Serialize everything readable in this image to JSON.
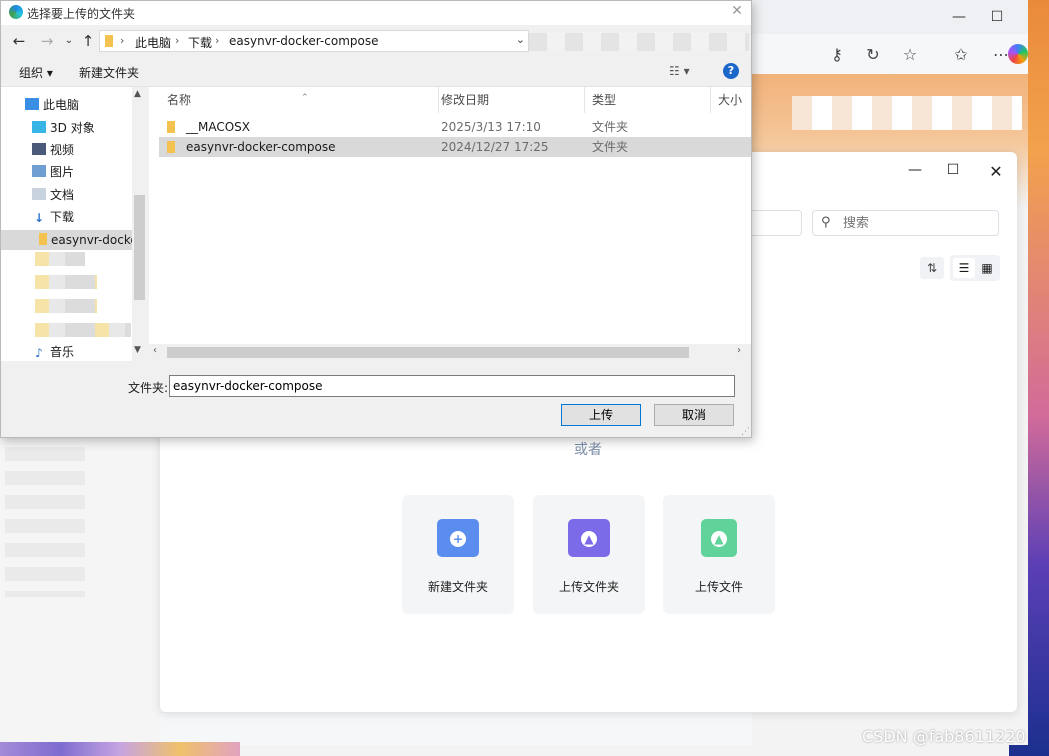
{
  "dialog": {
    "title": "选择要上传的文件夹",
    "breadcrumb": [
      "此电脑",
      "下载",
      "easynvr-docker-compose"
    ],
    "toolbar": {
      "organize": "组织 ▾",
      "new_folder": "新建文件夹",
      "help": "?"
    },
    "nav": [
      {
        "label": "此电脑",
        "icon": "computer-icon"
      },
      {
        "label": "3D 对象",
        "icon": "cube-icon"
      },
      {
        "label": "视频",
        "icon": "video-icon"
      },
      {
        "label": "图片",
        "icon": "picture-icon"
      },
      {
        "label": "文档",
        "icon": "document-icon"
      },
      {
        "label": "下载",
        "icon": "download-icon"
      },
      {
        "label": "easynvr-docke",
        "icon": "folder-icon",
        "selected": true
      },
      {
        "label": "音乐",
        "icon": "music-icon"
      }
    ],
    "columns": [
      "名称",
      "修改日期",
      "类型",
      "大小"
    ],
    "files": [
      {
        "name": "__MACOSX",
        "date": "2025/3/13 17:10",
        "type": "文件夹",
        "selected": false
      },
      {
        "name": "easynvr-docker-compose",
        "date": "2024/12/27 17:25",
        "type": "文件夹",
        "selected": true
      }
    ],
    "filename_label": "文件夹:",
    "filename_value": "easynvr-docker-compose",
    "upload_label": "上传",
    "cancel_label": "取消"
  },
  "app": {
    "search_placeholder": "搜索",
    "or_text": "或者",
    "cards": [
      {
        "label": "新建文件夹",
        "icon": "new-folder-icon",
        "color": "#5b8def"
      },
      {
        "label": "上传文件夹",
        "icon": "upload-folder-icon",
        "color": "#7b6be8"
      },
      {
        "label": "上传文件",
        "icon": "upload-file-icon",
        "color": "#5fd39a"
      }
    ]
  },
  "watermark": "CSDN @fab8611220"
}
